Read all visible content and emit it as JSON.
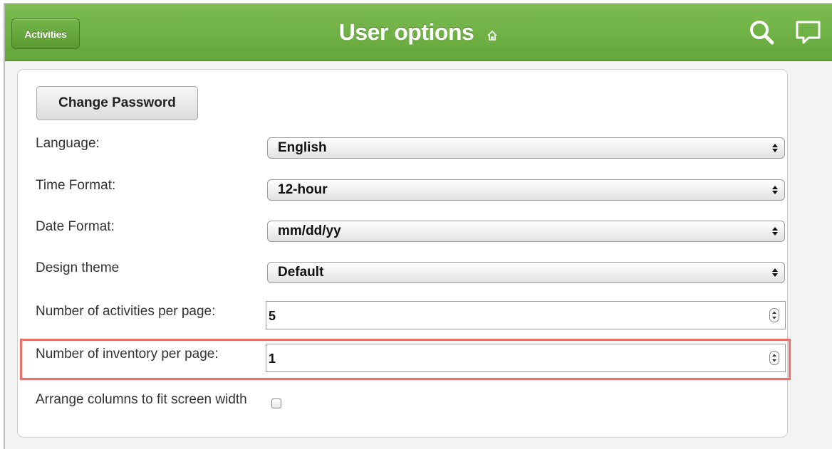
{
  "header": {
    "back_label": "Activities",
    "title": "User options",
    "accent_color": "#6aac3f"
  },
  "form": {
    "change_password_label": "Change Password",
    "language": {
      "label": "Language:",
      "value": "English"
    },
    "time_format": {
      "label": "Time Format:",
      "value": "12-hour"
    },
    "date_format": {
      "label": "Date Format:",
      "value": "mm/dd/yy"
    },
    "design_theme": {
      "label": "Design theme",
      "value": "Default"
    },
    "activities_per_page": {
      "label": "Number of activities per page:",
      "value": "5"
    },
    "inventory_per_page": {
      "label": "Number of inventory per page:",
      "value": "1"
    },
    "arrange_columns": {
      "label": "Arrange columns to fit screen width",
      "checked": false
    }
  },
  "icons": [
    "home-icon",
    "search-icon",
    "chat-icon",
    "select-arrows-icon",
    "spinner-icon"
  ],
  "highlight_color": "#e87068"
}
